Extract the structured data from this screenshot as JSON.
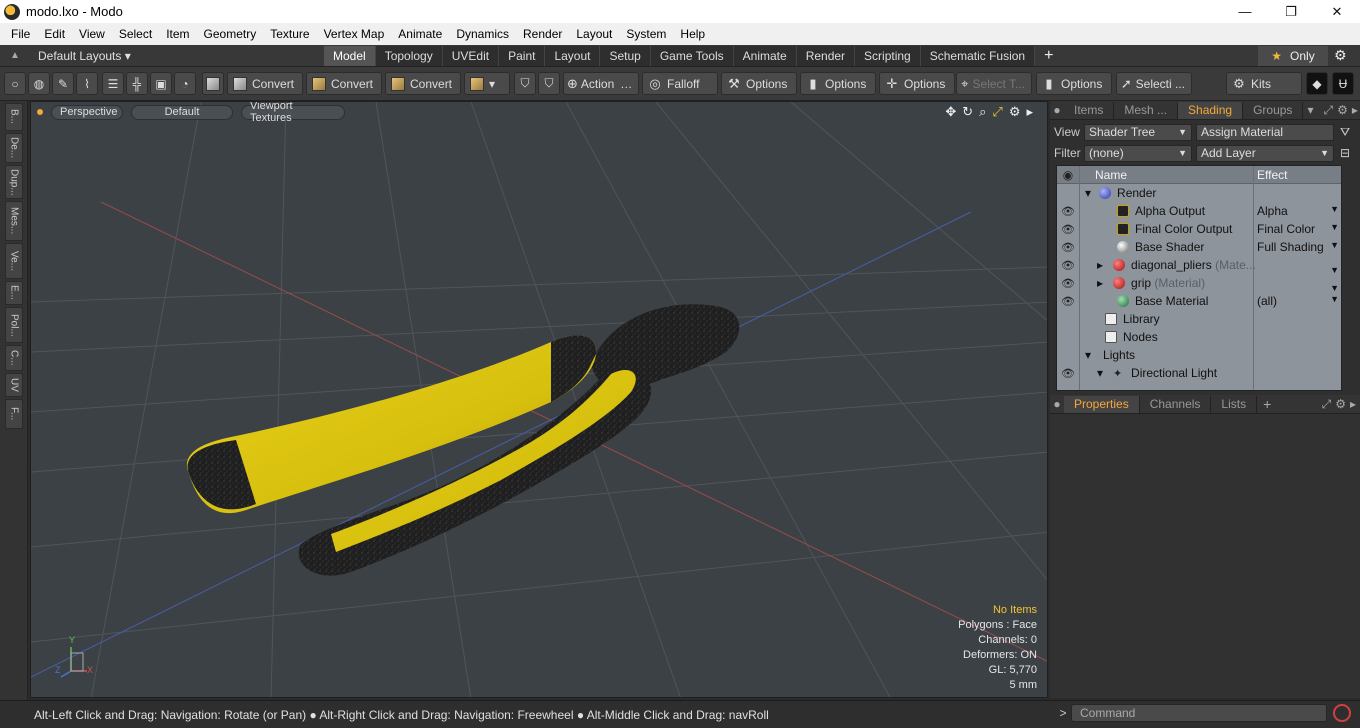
{
  "window": {
    "title": "modo.lxo - Modo",
    "minimize": "—",
    "maximize": "❐",
    "close": "✕"
  },
  "menu": [
    "File",
    "Edit",
    "View",
    "Select",
    "Item",
    "Geometry",
    "Texture",
    "Vertex Map",
    "Animate",
    "Dynamics",
    "Render",
    "Layout",
    "System",
    "Help"
  ],
  "layoutbar": {
    "layouts_label": "Default Layouts",
    "tabs": [
      "Model",
      "Topology",
      "UVEdit",
      "Paint",
      "Layout",
      "Setup",
      "Game Tools",
      "Animate",
      "Render",
      "Scripting",
      "Schematic Fusion"
    ],
    "active_tab": "Model",
    "add_tab": "+",
    "only_label": "Only"
  },
  "toolbar": {
    "convert1": "Convert",
    "convert2": "Convert",
    "convert3": "Convert",
    "action": "Action",
    "falloff": "Falloff",
    "options1": "Options",
    "options2": "Options",
    "options3": "Options",
    "select_t": "Select T...",
    "options4": "Options",
    "selecti": "Selecti ...",
    "kits": "Kits"
  },
  "leftstrip": [
    "B...",
    "De...",
    "Dup...",
    "Mes...",
    "Ve...",
    "E...",
    "Pol...",
    "C...",
    "UV",
    "F..."
  ],
  "viewport": {
    "view": "Perspective",
    "style": "Default",
    "textures": "Viewport Textures",
    "stats": {
      "items": "No Items",
      "polygons": "Polygons : Face",
      "channels": "Channels: 0",
      "deformers": "Deformers: ON",
      "gl": "GL: 5,770",
      "unit": "5 mm"
    },
    "axis": {
      "x": "X",
      "y": "Y",
      "z": "Z"
    }
  },
  "shading": {
    "tabs": [
      "Items",
      "Mesh ...",
      "Shading",
      "Groups"
    ],
    "active_tab": "Shading",
    "view_label": "View",
    "view_value": "Shader Tree",
    "assign_material": "Assign Material",
    "filter_label": "Filter",
    "filter_value": "(none)",
    "add_layer": "Add Layer",
    "col_name": "Name",
    "col_effect": "Effect",
    "rows": [
      {
        "name": "Render",
        "effect": "",
        "indent": 1,
        "eye": false
      },
      {
        "name": "Alpha Output",
        "effect": "Alpha",
        "indent": 2,
        "eye": true
      },
      {
        "name": "Final Color Output",
        "effect": "Final Color",
        "indent": 2,
        "eye": true
      },
      {
        "name": "Base Shader",
        "effect": "Full Shading",
        "indent": 2,
        "eye": true
      },
      {
        "name": "diagonal_pliers",
        "suffix": "(Mate...",
        "effect": "",
        "indent": 2,
        "eye": true
      },
      {
        "name": "grip",
        "suffix": "(Material)",
        "effect": "",
        "indent": 2,
        "eye": true
      },
      {
        "name": "Base Material",
        "effect": "(all)",
        "indent": 2,
        "eye": true
      },
      {
        "name": "Library",
        "effect": "",
        "indent": 1,
        "eye": false
      },
      {
        "name": "Nodes",
        "effect": "",
        "indent": 1,
        "eye": false
      },
      {
        "name": "Lights",
        "effect": "",
        "indent": 0,
        "eye": false
      },
      {
        "name": "Directional Light",
        "effect": "",
        "indent": 1,
        "eye": true
      }
    ]
  },
  "properties": {
    "tabs": [
      "Properties",
      "Channels",
      "Lists"
    ],
    "active_tab": "Properties",
    "add_tab": "+"
  },
  "statusbar": {
    "hint": "Alt-Left Click and Drag: Navigation: Rotate (or Pan) ● Alt-Right Click and Drag: Navigation: Freewheel ● Alt-Middle Click and Drag: navRoll",
    "prompt": ">",
    "command_placeholder": "Command"
  }
}
